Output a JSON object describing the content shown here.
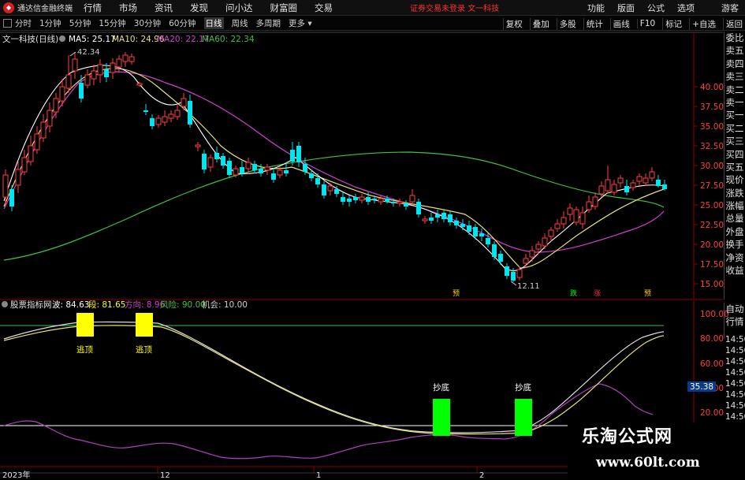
{
  "app": {
    "title": "通达信金融终端",
    "account_status": "证券交易未登录",
    "stock_name_tab": "文一科技"
  },
  "menu": [
    "行情",
    "市场",
    "资讯",
    "发现",
    "问小达",
    "财富圈",
    "交易"
  ],
  "right_menu": [
    "功能",
    "版面",
    "公式",
    "选项",
    "游客"
  ],
  "periods": [
    "分时",
    "1分钟",
    "5分钟",
    "15分钟",
    "30分钟",
    "60分钟",
    "日线",
    "周线",
    "多周期",
    "更多"
  ],
  "active_period": "日线",
  "toolbar_right": [
    "复权",
    "叠加",
    "多股",
    "统计",
    "画线",
    "F10",
    "标记",
    "+自选",
    "返回"
  ],
  "colors": {
    "up": "#ff4040",
    "down": "#00e5ee",
    "ma5": "#ffffff",
    "ma10": "#e6e07a",
    "ma20": "#d040d0",
    "ma60": "#40c040",
    "signal": "#ffff00",
    "buy": "#00ff00"
  },
  "main_chart": {
    "stock_label": "文一科技(日线)",
    "ma_labels": [
      {
        "text": "MA5: 25.17",
        "color": "#ffffff"
      },
      {
        "text": "MA10: 24.96",
        "color": "#e6e07a"
      },
      {
        "text": "MA20: 22.17",
        "color": "#d040d0"
      },
      {
        "text": "MA60: 22.34",
        "color": "#40c040"
      }
    ],
    "y_ticks": [
      "40.00",
      "37.50",
      "35.00",
      "32.50",
      "30.00",
      "27.50",
      "25.00",
      "22.50",
      "20.00",
      "17.50",
      "15.00"
    ],
    "high_label": "42.34",
    "low_label": "12.11",
    "marks": [
      {
        "text": "预",
        "color": "#ffd000"
      },
      {
        "text": "跌",
        "color": "#00ff00"
      },
      {
        "text": "涨",
        "color": "#ff3030"
      },
      {
        "text": "预",
        "color": "#ffd000"
      }
    ]
  },
  "side_panel": [
    "委比",
    "卖五",
    "卖四",
    "卖三",
    "卖二",
    "卖一",
    "买一",
    "买二",
    "买三",
    "买四",
    "买五",
    "现价",
    "涨跌",
    "涨幅",
    "总量",
    "外盘",
    "换手",
    "净资",
    "收益"
  ],
  "side_panel2": [
    "自动",
    "行情"
  ],
  "side_times": [
    "14:50",
    "14:50",
    "14:50",
    "14:50",
    "14:50",
    "14:50",
    "14:50",
    "14:50"
  ],
  "indicator": {
    "title": "股票指标网",
    "values": [
      {
        "label": "波: 84.63",
        "color": "#ffffff"
      },
      {
        "label": "段: 81.65",
        "color": "#ffff00"
      },
      {
        "label": "方向: 8.96",
        "color": "#d040d0"
      },
      {
        "label": "风险: 90.00",
        "color": "#40c040"
      },
      {
        "label": "机会: 10.00",
        "color": "#cccccc"
      }
    ],
    "y_ticks": [
      "100.00",
      "80.00",
      "60.00",
      "40.00",
      "20.00"
    ],
    "current_value": "35.38",
    "sell_signals": [
      "逃顶",
      "逃顶"
    ],
    "buy_signals": [
      "抄底",
      "抄底"
    ]
  },
  "x_axis": [
    "2023年",
    "12",
    "1",
    "2"
  ],
  "watermark": {
    "title": "乐淘公式网",
    "url": "www.60lt.com"
  }
}
